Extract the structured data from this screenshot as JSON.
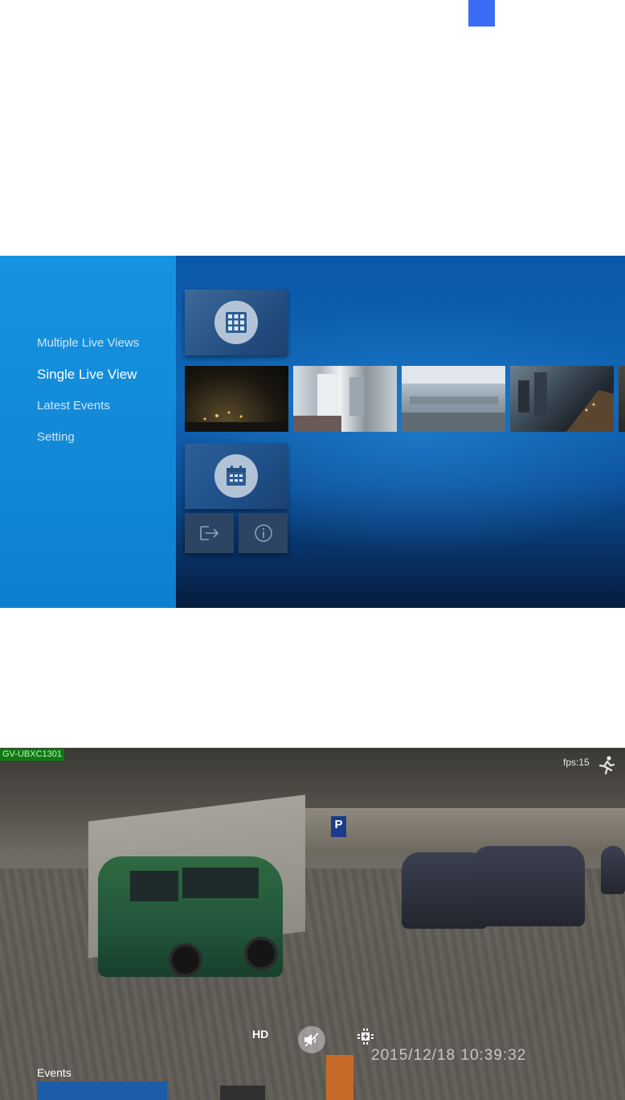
{
  "tv_menu": {
    "sidebar": {
      "items": [
        {
          "label": "Multiple Live Views",
          "active": false
        },
        {
          "label": "Single Live View",
          "active": true
        },
        {
          "label": "Latest Events",
          "active": false
        },
        {
          "label": "Setting",
          "active": false
        }
      ]
    },
    "tiles": {
      "live_grid_icon": "grid-icon",
      "playback_icon": "calendar-icon",
      "exit_icon": "exit-icon",
      "info_icon": "info-icon"
    },
    "colors": {
      "sidebar": "#1593e0",
      "main_bg": "#0c58a8",
      "accent_tab": "#3b6cf6"
    }
  },
  "live_view": {
    "camera_name": "GV-UBXC1301",
    "fps": "fps:15",
    "hd_label": "HD",
    "timestamp": "2015/12/18   10:39:32",
    "events_label": "Events",
    "parking_sign": "P",
    "icons": {
      "motion": "running-person-icon",
      "audio": "speaker-mute-icon",
      "ptz": "ptz-icon"
    },
    "colors": {
      "camera_label_bg": "#0f7a12"
    }
  }
}
